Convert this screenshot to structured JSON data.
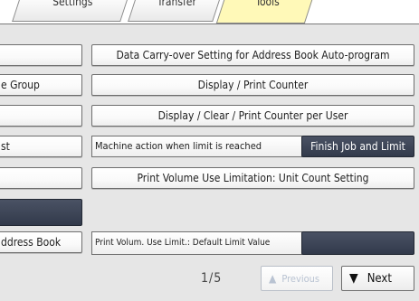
{
  "tabs": [
    {
      "label": "Settings"
    },
    {
      "label": "Transfer"
    },
    {
      "label": "Tools"
    }
  ],
  "left_column": {
    "row2_label": "e Group",
    "row4_label": "st",
    "row7_label": "ddress Book"
  },
  "right_column": {
    "data_carry_over": "Data Carry-over Setting for Address Book Auto-program",
    "display_print_counter": "Display / Print Counter",
    "display_clear_counter_per_user": "Display / Clear / Print Counter per User",
    "machine_action_label": "Machine action when limit is reached",
    "machine_action_value": "Finish Job and Limit",
    "print_volume_limitation": "Print Volume Use Limitation: Unit Count Setting",
    "default_limit_label": "Print Volum. Use Limit.: Default Limit Value",
    "default_limit_value": ""
  },
  "pagination": {
    "indicator": "1/5",
    "previous_label": "Previous",
    "next_label": "Next"
  },
  "icons": {
    "previous": "triangle-up-icon",
    "next": "triangle-down-icon"
  },
  "colors": {
    "active_tab": "#fff9b8",
    "selected_value_bg": "#3a4254",
    "panel_bg": "#e6e6e6"
  }
}
